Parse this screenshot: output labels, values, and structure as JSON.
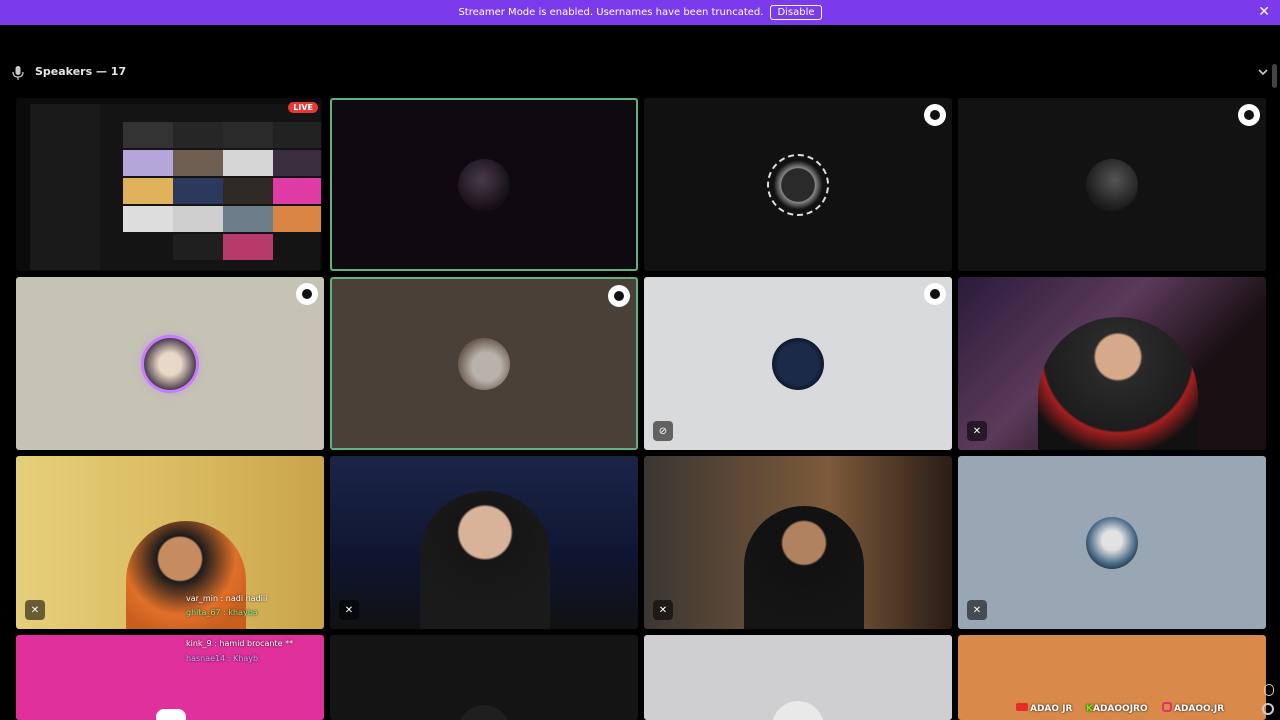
{
  "banner": {
    "message": "Streamer Mode is enabled. Usernames have been truncated.",
    "disable_label": "Disable",
    "close_icon": "close-icon"
  },
  "speakers": {
    "title": "Speakers — 17",
    "mic_icon": "microphone-icon",
    "chevron_icon": "chevron-down-icon"
  },
  "tiles": {
    "live_label": "LIVE"
  },
  "chat": {
    "line1": "var_min : nadi nadiii",
    "line2": "ghita_67 : khayba",
    "line3": "kink_9 : hamid brocante **",
    "line4": "hasnae14 : Khayb"
  },
  "socials": {
    "youtube": "ADAO JR",
    "kick": "ADAOOJRO",
    "instagram": "ADAOO.JR"
  },
  "colors": {
    "banner": "#7c3aed",
    "selected_border": "#5fb27b",
    "live": "#e53935"
  }
}
